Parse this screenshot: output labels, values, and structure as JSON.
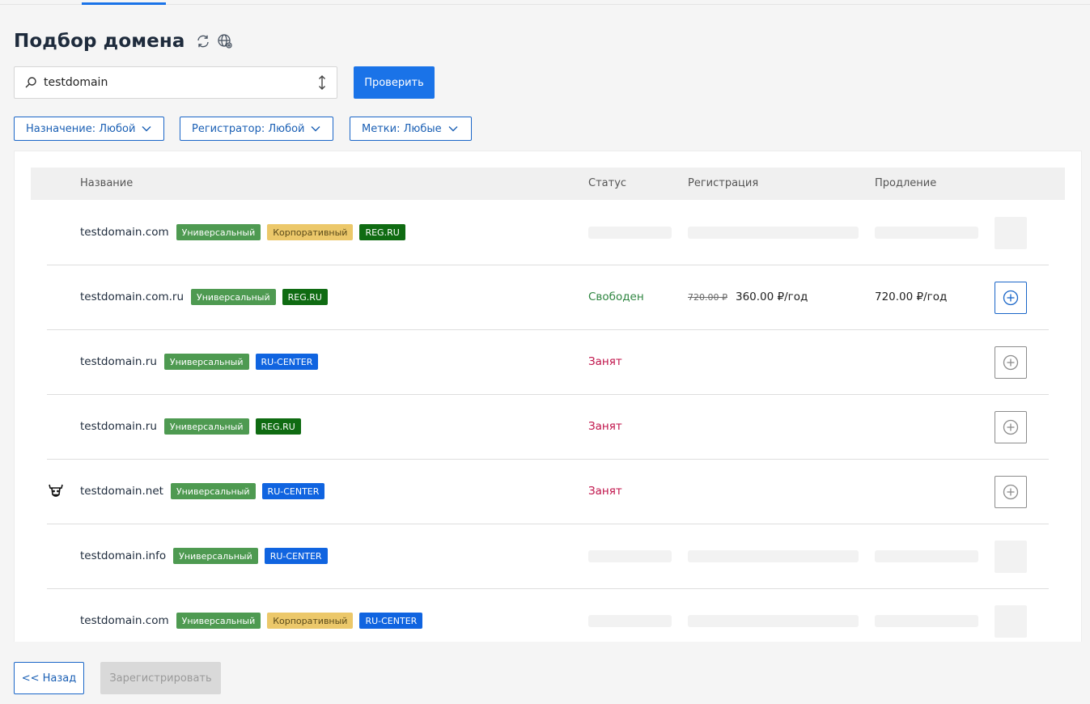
{
  "page": {
    "title": "Подбор домена",
    "title_icons": [
      "refresh-icon",
      "globe-settings-icon"
    ]
  },
  "search": {
    "value": "testdomain",
    "placeholder": "",
    "button_label": "Проверить"
  },
  "filters": [
    {
      "label": "Назначение: Любой"
    },
    {
      "label": "Регистратор: Любой"
    },
    {
      "label": "Метки: Любые"
    }
  ],
  "table": {
    "columns": [
      "Название",
      "Статус",
      "Регистрация",
      "Продление"
    ],
    "rows": [
      {
        "domain": "testdomain.com",
        "tags": [
          "Универсальный",
          "Корпоративный",
          "REG.RU"
        ],
        "status": "",
        "old_price": "",
        "reg_price": "",
        "renew_price": "",
        "loading": true
      },
      {
        "domain": "testdomain.com.ru",
        "tags": [
          "Универсальный",
          "REG.RU"
        ],
        "status": "Свободен",
        "old_price": "720.00 ₽",
        "reg_price": "360.00 ₽/год",
        "renew_price": "720.00 ₽/год",
        "loading": false
      },
      {
        "domain": "testdomain.ru",
        "tags": [
          "Универсальный",
          "RU-CENTER"
        ],
        "status": "Занят",
        "old_price": "",
        "reg_price": "",
        "renew_price": "",
        "loading": false
      },
      {
        "domain": "testdomain.ru",
        "tags": [
          "Универсальный",
          "REG.RU"
        ],
        "status": "Занят",
        "old_price": "",
        "reg_price": "",
        "renew_price": "",
        "loading": false
      },
      {
        "domain": "testdomain.net",
        "tags": [
          "Универсальный",
          "RU-CENTER"
        ],
        "status": "Занят",
        "old_price": "",
        "reg_price": "",
        "renew_price": "",
        "loading": false,
        "logo": "bull-head-icon"
      },
      {
        "domain": "testdomain.info",
        "tags": [
          "Универсальный",
          "RU-CENTER"
        ],
        "status": "",
        "old_price": "",
        "reg_price": "",
        "renew_price": "",
        "loading": true
      },
      {
        "domain": "testdomain.com",
        "tags": [
          "Универсальный",
          "Корпоративный",
          "RU-CENTER"
        ],
        "status": "",
        "old_price": "",
        "reg_price": "",
        "renew_price": "",
        "loading": true
      }
    ]
  },
  "footer": {
    "back_label": "<< Назад",
    "register_label": "Зарегистрировать"
  },
  "colors": {
    "accent": "#1a73e8",
    "free": "#2e8540",
    "busy": "#c0134a",
    "tag_universal": "#4e9a51",
    "tag_corporate": "#ecc86a",
    "tag_regru": "#0f6b12",
    "tag_rucenter": "#1064e0"
  }
}
